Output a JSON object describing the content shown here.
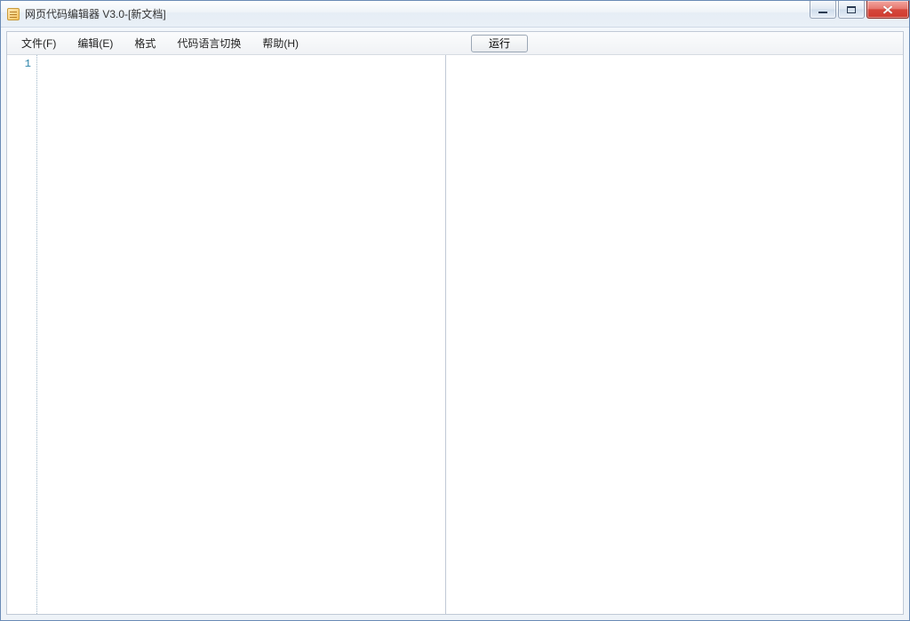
{
  "window": {
    "title": "网页代码编辑器 V3.0-[新文档]"
  },
  "menu": {
    "items": [
      "文件(F)",
      "编辑(E)",
      "格式",
      "代码语言切换",
      "帮助(H)"
    ],
    "run_label": "运行"
  },
  "editor": {
    "line_numbers": [
      "1"
    ],
    "content": ""
  }
}
